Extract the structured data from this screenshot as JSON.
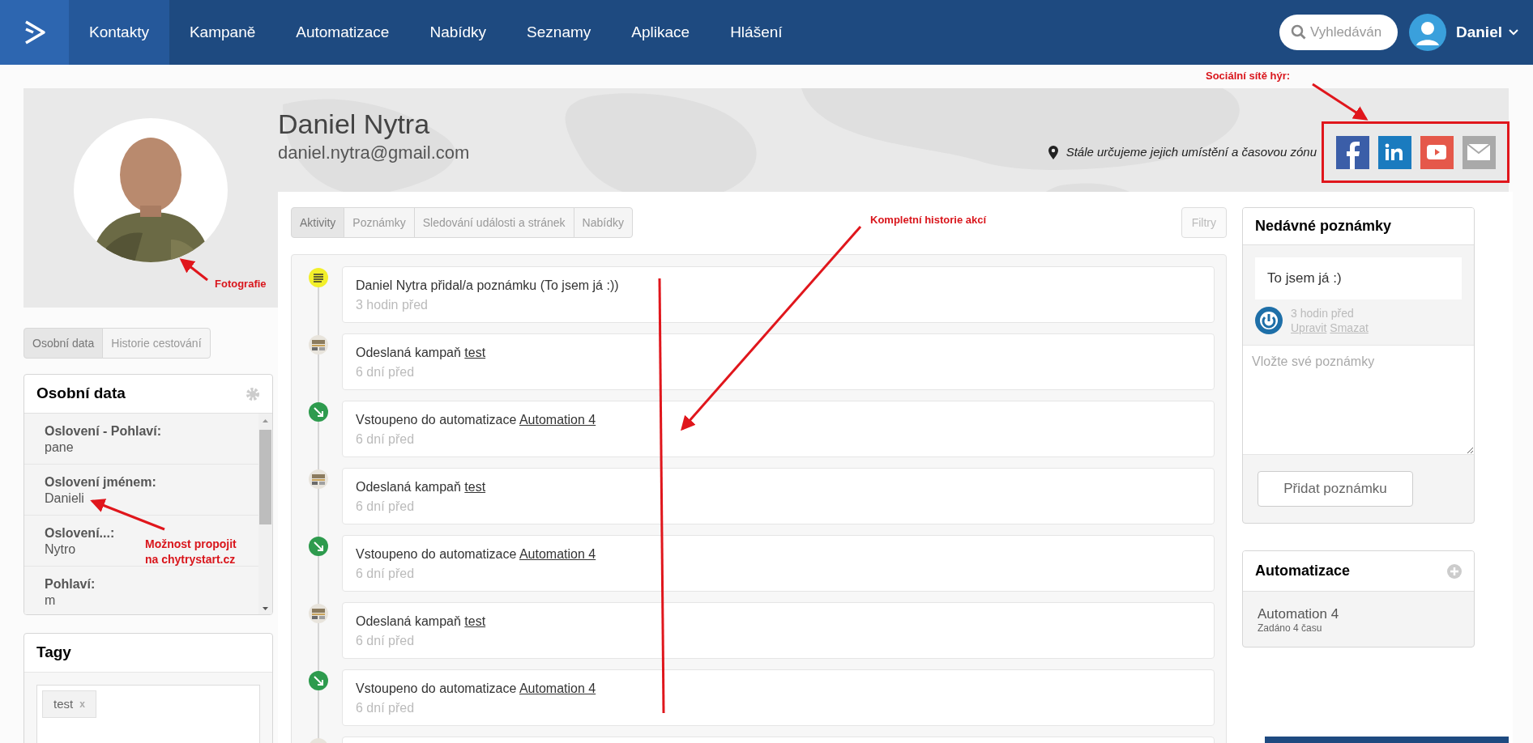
{
  "nav": {
    "items": [
      {
        "label": "Kontakty",
        "selected": true
      },
      {
        "label": "Kampaně",
        "selected": false
      },
      {
        "label": "Automatizace",
        "selected": false
      },
      {
        "label": "Nabídky",
        "selected": false
      },
      {
        "label": "Seznamy",
        "selected": false
      },
      {
        "label": "Aplikace",
        "selected": false
      },
      {
        "label": "Hlášení",
        "selected": false
      }
    ],
    "search": {
      "placeholder": "Vyhledáván"
    },
    "user": "Daniel"
  },
  "contact": {
    "name": "Daniel Nytra",
    "email": "daniel.nytra@gmail.com",
    "location": "Stále určujeme jejich umístění a časovou zónu"
  },
  "left_tabs": [
    {
      "label": "Osobní data",
      "selected": true
    },
    {
      "label": "Historie cestování",
      "selected": false
    }
  ],
  "personal": {
    "title": "Osobní data",
    "fields": [
      {
        "label": "Oslovení - Pohlaví:",
        "value": "pane"
      },
      {
        "label": "Oslovení jménem:",
        "value": "Danieli"
      },
      {
        "label": "Oslovení...:",
        "value": "Nytro"
      },
      {
        "label": "Pohlaví:",
        "value": "m"
      }
    ]
  },
  "tags": {
    "title": "Tagy",
    "items": [
      "test"
    ],
    "remove": "x"
  },
  "activity_tabs": [
    {
      "label": "Aktivity",
      "selected": true
    },
    {
      "label": "Poznámky",
      "selected": false
    },
    {
      "label": "Sledování události a stránek",
      "selected": false
    },
    {
      "label": "Nabídky",
      "selected": false
    }
  ],
  "filter_button": "Filtry",
  "timeline": [
    {
      "kind": "note",
      "text": "Daniel Nytra přidal/a poznámku (To jsem já :))",
      "time": "3 hodin před"
    },
    {
      "kind": "campaign",
      "text": "Odeslaná kampaň",
      "link": "test",
      "time": "6 dní před"
    },
    {
      "kind": "automation",
      "text": "Vstoupeno do automatizace",
      "link": "Automation 4",
      "time": "6 dní před"
    },
    {
      "kind": "campaign",
      "text": "Odeslaná kampaň",
      "link": "test",
      "time": "6 dní před"
    },
    {
      "kind": "automation",
      "text": "Vstoupeno do automatizace",
      "link": "Automation 4",
      "time": "6 dní před"
    },
    {
      "kind": "campaign",
      "text": "Odeslaná kampaň",
      "link": "test",
      "time": "6 dní před"
    },
    {
      "kind": "automation",
      "text": "Vstoupeno do automatizace",
      "link": "Automation 4",
      "time": "6 dní před"
    },
    {
      "kind": "campaign"
    }
  ],
  "notes": {
    "title": "Nedávné poznámky",
    "note": "To jsem já :)",
    "time": "3 hodin před",
    "edit": "Upravit",
    "delete": "Smazat",
    "placeholder": "Vložte své poznámky",
    "add_button": "Přidat poznámku"
  },
  "automations": {
    "title": "Automatizace",
    "items": [
      {
        "name": "Automation 4",
        "detail": "Zadáno 4 času"
      }
    ]
  },
  "annotations": [
    {
      "text": "Sociální sítě hýr:"
    },
    {
      "text": "Fotografie"
    },
    {
      "text": "Kompletní historie akcí"
    },
    {
      "text": "Možnost propojit na chytrystart.cz"
    }
  ]
}
